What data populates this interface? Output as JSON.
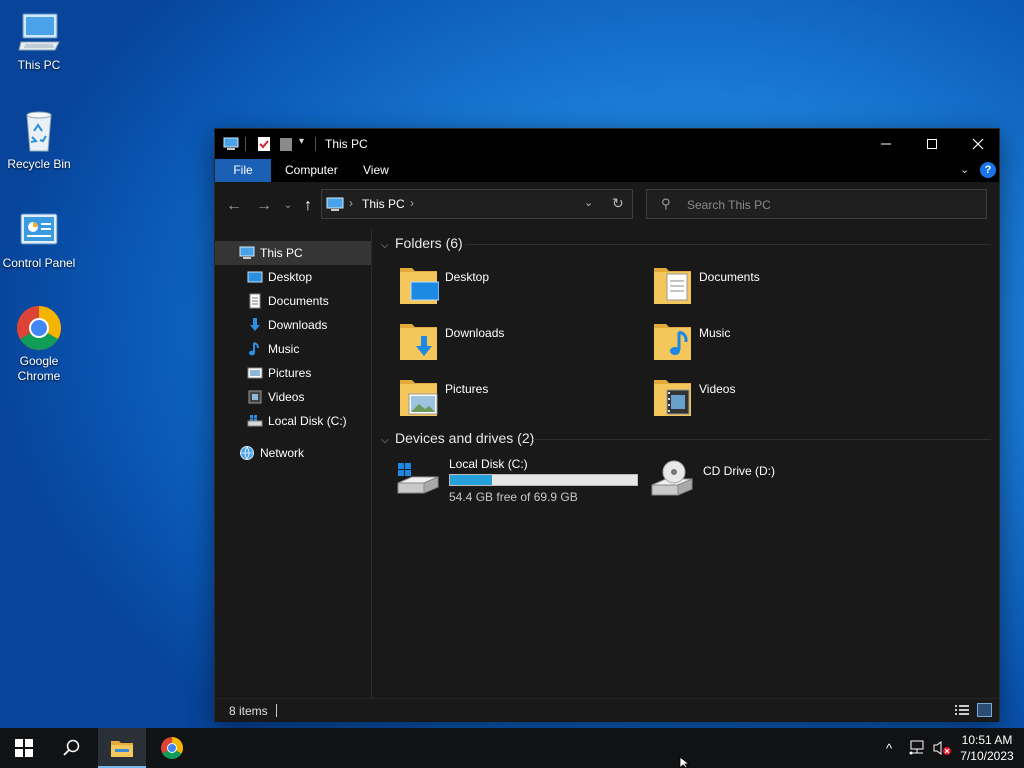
{
  "desktop": {
    "icons": [
      {
        "label": "This PC",
        "icon": "computer-icon"
      },
      {
        "label": "Recycle Bin",
        "icon": "recycle-bin-icon"
      },
      {
        "label": "Control Panel",
        "icon": "control-panel-icon"
      },
      {
        "label": "Google Chrome",
        "icon": "chrome-icon"
      }
    ]
  },
  "window": {
    "title": "This PC",
    "ribbon_tabs": [
      "File",
      "Computer",
      "View"
    ],
    "help": "?",
    "address": {
      "crumb": "This PC",
      "sep": "›"
    },
    "search_placeholder": "Search This PC",
    "nav": {
      "root": "This PC",
      "items": [
        "Desktop",
        "Documents",
        "Downloads",
        "Music",
        "Pictures",
        "Videos",
        "Local Disk (C:)"
      ],
      "network": "Network"
    },
    "groups": {
      "folders": "Folders (6)",
      "devices": "Devices and drives (2)"
    },
    "folders": [
      "Desktop",
      "Documents",
      "Downloads",
      "Music",
      "Pictures",
      "Videos"
    ],
    "drives": [
      {
        "name": "Local Disk (C:)",
        "free": "54.4 GB free of 69.9 GB",
        "used_fraction": 0.222
      },
      {
        "name": "CD Drive (D:)"
      }
    ],
    "status": {
      "count": "8 items"
    }
  },
  "taskbar": {
    "clock_time": "10:51 AM",
    "clock_date": "7/10/2023"
  },
  "colors": {
    "accent": "#1a5fb4",
    "drive_fill": "#26a0da",
    "folder": "#f4c75c"
  }
}
